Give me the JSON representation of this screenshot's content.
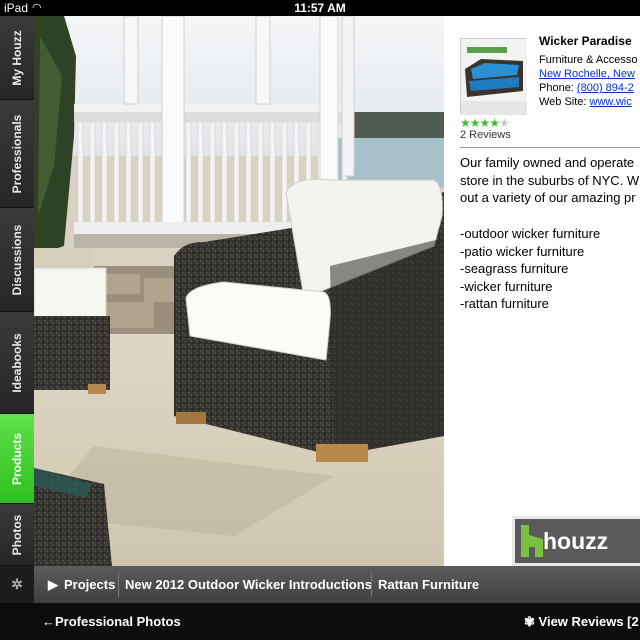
{
  "status_bar": {
    "carrier": "iPad",
    "time": "11:57 AM"
  },
  "side_tabs": [
    {
      "label": "My Houzz",
      "active": false
    },
    {
      "label": "Professionals",
      "active": false
    },
    {
      "label": "Discussions",
      "active": false
    },
    {
      "label": "Ideabooks",
      "active": false
    },
    {
      "label": "Products",
      "active": true
    },
    {
      "label": "Photos",
      "active": false
    }
  ],
  "business": {
    "name": "Wicker Paradise",
    "category": "Furniture & Accesso",
    "location": "New Rochelle, New",
    "phone_label": "Phone: ",
    "phone": "(800) 894-2",
    "website_label": "Web Site: ",
    "website": "www.wic",
    "rating": 4,
    "rating_max": 5,
    "reviews": "2 Reviews",
    "description": [
      "Our family owned and operate",
      "store in the suburbs of NYC. W",
      "out a variety of our amazing pr"
    ],
    "offerings": [
      "-outdoor wicker furniture",
      "-patio wicker furniture",
      "-seagrass furniture",
      "-wicker furniture",
      "-rattan furniture"
    ],
    "logo_text": "houzz"
  },
  "breadcrumbs": {
    "projects": "Projects",
    "item1": "New 2012 Outdoor Wicker Introductions",
    "item2": "Rattan Furniture"
  },
  "bottom_bar": {
    "back_label": "Professional Photos",
    "reviews_label": "View Reviews [2"
  },
  "colors": {
    "active_tab": "#3fcf2c",
    "star": "#3cbf2a",
    "link": "#0033cc"
  }
}
